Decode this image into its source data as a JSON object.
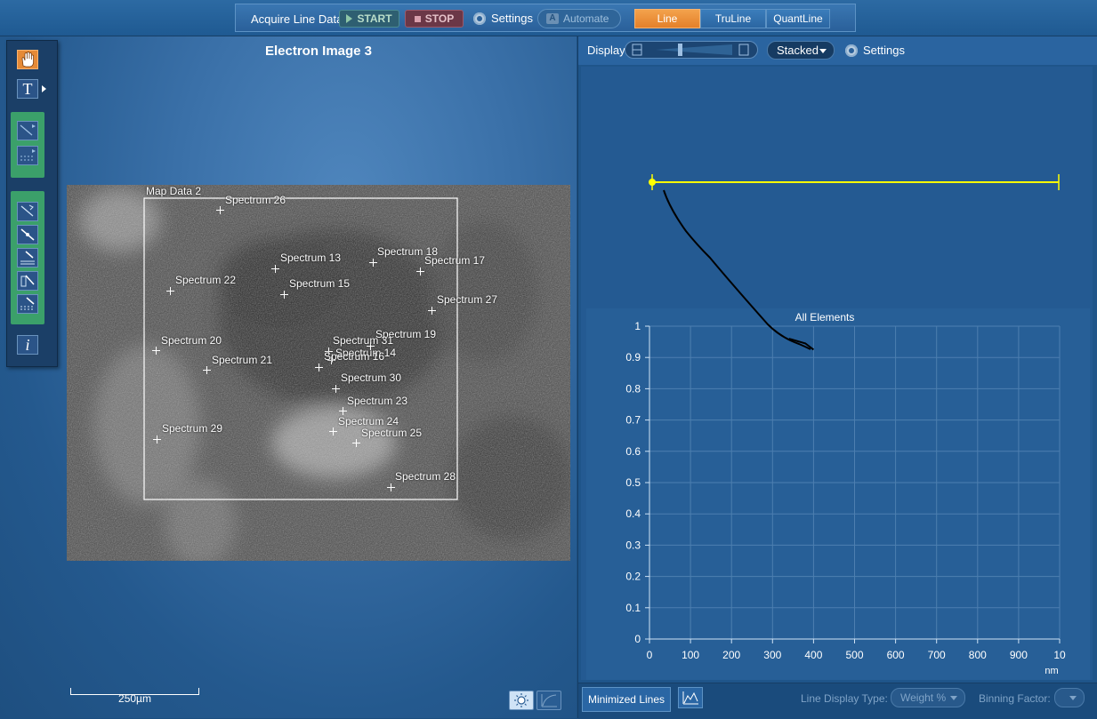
{
  "toolbar": {
    "acquire_label": "Acquire Line Data",
    "start_label": "START",
    "stop_label": "STOP",
    "settings_label": "Settings",
    "automate_label": "Automate",
    "automate_letter": "A",
    "modes": [
      "Line",
      "TruLine",
      "QuantLine"
    ],
    "active_mode": "Line"
  },
  "left": {
    "image_title": "Electron Image 3",
    "map_label": "Map Data 2",
    "spectra": [
      "Spectrum 26",
      "Spectrum 13",
      "Spectrum 18",
      "Spectrum 17",
      "Spectrum 22",
      "Spectrum 15",
      "Spectrum 27",
      "Spectrum 19",
      "Spectrum 31",
      "Spectrum 20",
      "Spectrum 14",
      "Spectrum 16",
      "Spectrum 21",
      "Spectrum 30",
      "Spectrum 23",
      "Spectrum 24",
      "Spectrum 29",
      "Spectrum 25",
      "Spectrum 28"
    ],
    "scale_label": "250µm",
    "text_tool_letter": "T",
    "info_letter": "i"
  },
  "right": {
    "display_label": "Display",
    "stacked_label": "Stacked",
    "settings_label": "Settings",
    "bottom": {
      "minimized_lines": "Minimized Lines",
      "line_display_type_label": "Line Display Type:",
      "line_display_type_value": "Weight %",
      "binning_factor_label": "Binning Factor:"
    }
  },
  "chart_data": {
    "type": "line",
    "title": "All Elements",
    "xlabel": "nm",
    "ylabel": "",
    "xlim": [
      0,
      1000
    ],
    "ylim": [
      0,
      1
    ],
    "x_ticks": [
      "0",
      "100",
      "200",
      "300",
      "400",
      "500",
      "600",
      "700",
      "800",
      "900",
      "10"
    ],
    "y_ticks": [
      "0",
      "0.1",
      "0.2",
      "0.3",
      "0.4",
      "0.5",
      "0.6",
      "0.7",
      "0.8",
      "0.9",
      "1"
    ],
    "grid": true,
    "series": [
      {
        "name": "",
        "x": [
          340,
          380,
          390,
          400
        ],
        "y": [
          0.96,
          0.945,
          0.935,
          0.925
        ]
      }
    ]
  },
  "colors": {
    "accent": "#e4802a",
    "line_marker": "#ffff00",
    "background": "#1d4f80"
  }
}
